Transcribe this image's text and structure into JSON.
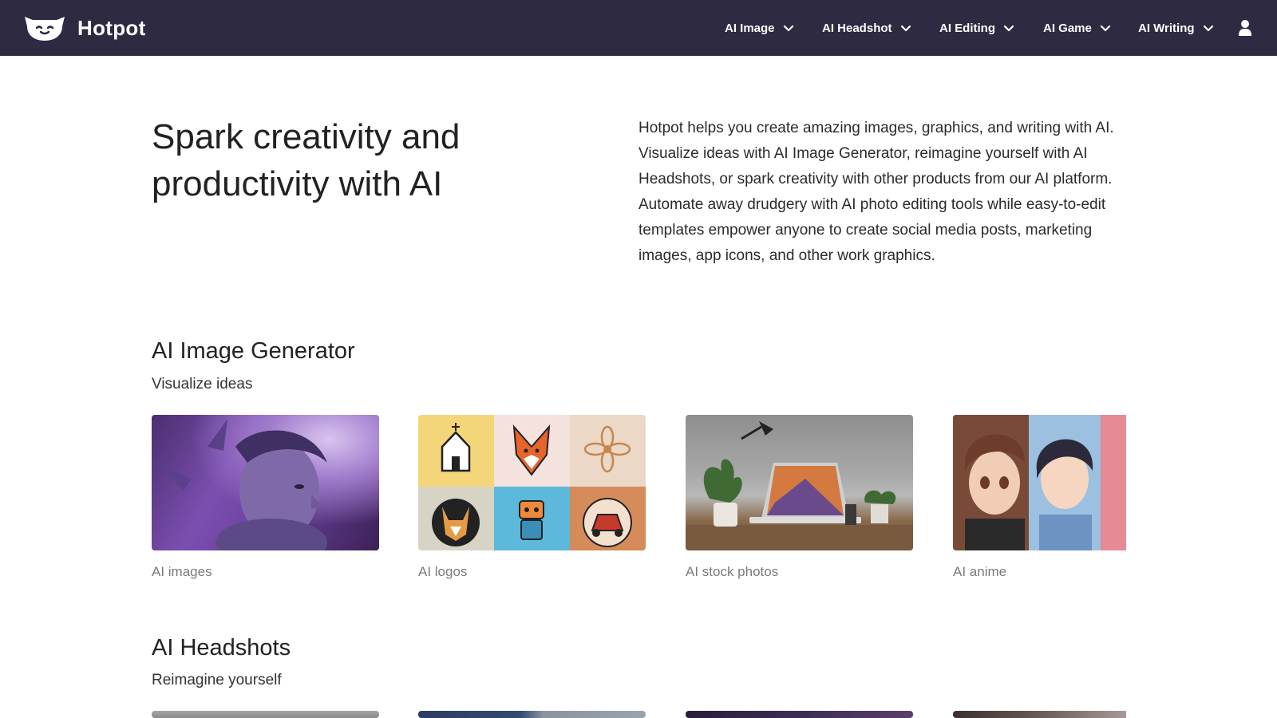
{
  "nav": {
    "brand": "Hotpot",
    "items": [
      {
        "label": "AI Image"
      },
      {
        "label": "AI Headshot"
      },
      {
        "label": "AI Editing"
      },
      {
        "label": "AI Game"
      },
      {
        "label": "AI Writing"
      }
    ],
    "icons": [
      "hotpot-logo-icon",
      "chevron-down-icon",
      "user-icon"
    ]
  },
  "hero": {
    "title": "Spark creativity and productivity with AI",
    "description": "Hotpot helps you create amazing images, graphics, and writing with AI. Visualize ideas with AI Image Generator, reimagine yourself with AI Headshots, or spark creativity with other products from our AI platform. Automate away drudgery with AI photo editing tools while easy-to-edit templates empower anyone to create social media posts, marketing images, app icons, and other work graphics."
  },
  "sections": [
    {
      "title": "AI Image Generator",
      "subtitle": "Visualize ideas",
      "cards": [
        {
          "label": "AI images"
        },
        {
          "label": "AI logos"
        },
        {
          "label": "AI stock photos"
        },
        {
          "label": "AI anime"
        }
      ]
    },
    {
      "title": "AI Headshots",
      "subtitle": "Reimagine yourself"
    }
  ],
  "colors": {
    "nav_background": "#2e2a42",
    "text": "#222222",
    "label_gray": "#7a7a7a"
  }
}
